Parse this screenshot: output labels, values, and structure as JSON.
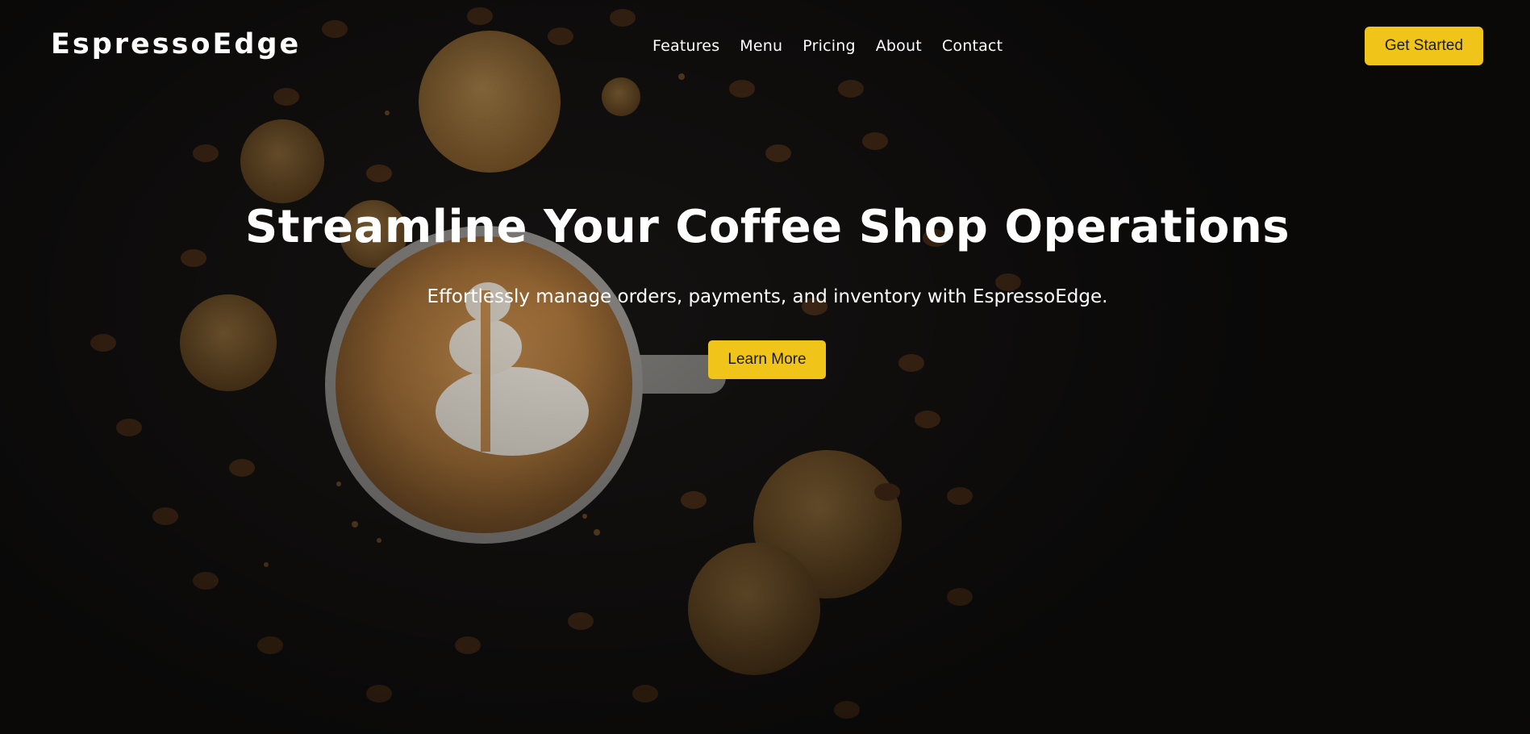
{
  "brand": {
    "name": "EspressoEdge"
  },
  "nav": {
    "links": [
      "Features",
      "Menu",
      "Pricing",
      "About",
      "Contact"
    ],
    "cta_label": "Get Started"
  },
  "hero": {
    "title": "Streamline Your Coffee Shop Operations",
    "subtitle": "Effortlessly manage orders, payments, and inventory with EspressoEdge.",
    "cta_label": "Learn More"
  },
  "colors": {
    "accent": "#f0c419",
    "background": "#121110",
    "text": "#ffffff"
  }
}
